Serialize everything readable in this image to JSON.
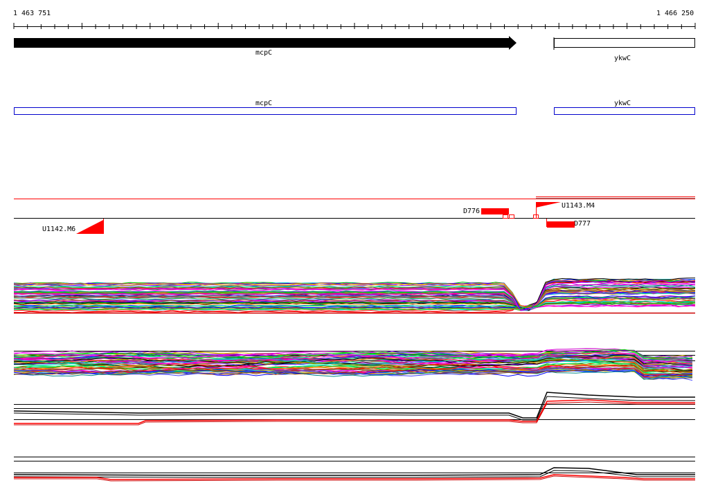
{
  "ruler": {
    "start_label": "1 463 751",
    "end_label": "1 466 250"
  },
  "genes": [
    {
      "name": "mcpC",
      "strand": "+"
    },
    {
      "name": "ykwC",
      "strand": "+"
    }
  ],
  "annotations": {
    "mcpC_label": "mcpC",
    "ykwC_label": "ykwC"
  },
  "features": {
    "u1143": "U1143.M4",
    "u1142": "U1142.M6",
    "d776": "D776",
    "d777": "D777"
  },
  "colors": {
    "gene_arrow": "#000000",
    "annotation_box": "#0000cc",
    "feature": "#ff0000",
    "track_line": "#000000"
  }
}
